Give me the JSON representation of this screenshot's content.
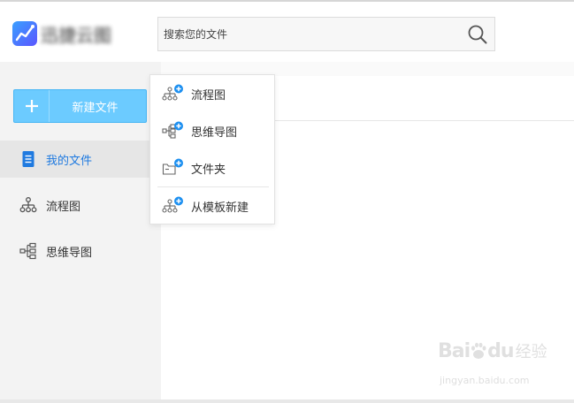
{
  "header": {
    "brand_chars": [
      "迅",
      "捷",
      "云",
      "图"
    ],
    "search_placeholder": "搜索您的文件"
  },
  "sidebar": {
    "new_button_label": "新建文件",
    "items": [
      {
        "label": "我的文件",
        "icon": "document-icon",
        "active": true
      },
      {
        "label": "流程图",
        "icon": "flowchart-icon",
        "active": false
      },
      {
        "label": "思维导图",
        "icon": "mindmap-icon",
        "active": false
      }
    ]
  },
  "new_menu": {
    "items": [
      {
        "label": "流程图",
        "icon": "new-flowchart-icon"
      },
      {
        "label": "思维导图",
        "icon": "new-mindmap-icon"
      },
      {
        "label": "文件夹",
        "icon": "new-folder-icon"
      },
      {
        "label": "从模板新建",
        "icon": "new-from-template-icon"
      }
    ]
  },
  "watermark": {
    "main": "Bai",
    "mid": "du",
    "cn": "经验",
    "url": "jingyan.baidu.com"
  },
  "colors": {
    "accent": "#1f7ae0",
    "new_button": "#6ccbff",
    "badge": "#1c8ff0"
  }
}
